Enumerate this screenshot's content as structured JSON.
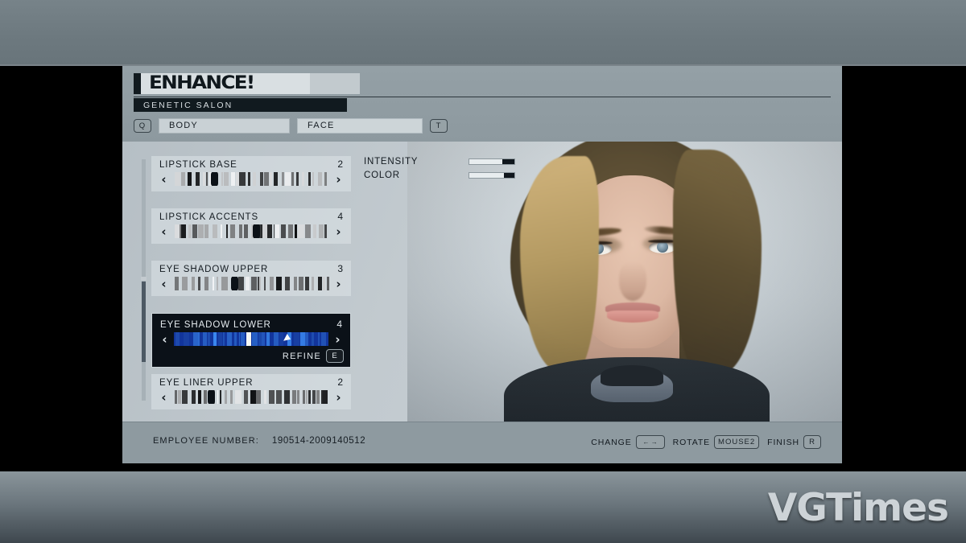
{
  "window": {
    "watermark": "VGTimes"
  },
  "header": {
    "logo": "ENHANCE!",
    "subtitle": "GENETIC SALON",
    "left_key": "Q",
    "right_key": "T",
    "tabs": [
      {
        "label": "BODY",
        "active": false
      },
      {
        "label": "FACE",
        "active": true
      }
    ]
  },
  "sliders": [
    {
      "label": "LIPSTICK BASE",
      "value": "2",
      "knob_pct": 24,
      "selected": false
    },
    {
      "label": "LIPSTICK ACCENTS",
      "value": "4",
      "knob_pct": 51,
      "selected": false
    },
    {
      "label": "EYE SHADOW UPPER",
      "value": "3",
      "knob_pct": 37,
      "selected": false
    },
    {
      "label": "EYE SHADOW LOWER",
      "value": "4",
      "knob_pct": 47,
      "selected": true,
      "refine_label": "REFINE",
      "refine_key": "E",
      "cursor_pct": 72
    },
    {
      "label": "EYE LINER UPPER",
      "value": "2",
      "knob_pct": 22,
      "selected": false
    }
  ],
  "params": [
    {
      "label": "INTENSITY",
      "fill_pct": 26
    },
    {
      "label": "COLOR",
      "fill_pct": 24
    }
  ],
  "footer": {
    "employee_label": "EMPLOYEE NUMBER:",
    "employee_number": "190514-2009140512",
    "hints": [
      {
        "label": "CHANGE",
        "key": "← →",
        "wide": false,
        "arrows": true
      },
      {
        "label": "ROTATE",
        "key": "MOUSE2",
        "wide": true,
        "arrows": false
      },
      {
        "label": "FINISH",
        "key": "R",
        "wide": false,
        "arrows": false
      }
    ]
  },
  "colors": {
    "panel_bg": "#8f9ba1",
    "content_bg": "#b9c2c7",
    "selected_row_bg": "#0b1118",
    "selected_track_blue": "#12359c",
    "text_dark": "#131a20",
    "text_light": "#e4eaee"
  }
}
